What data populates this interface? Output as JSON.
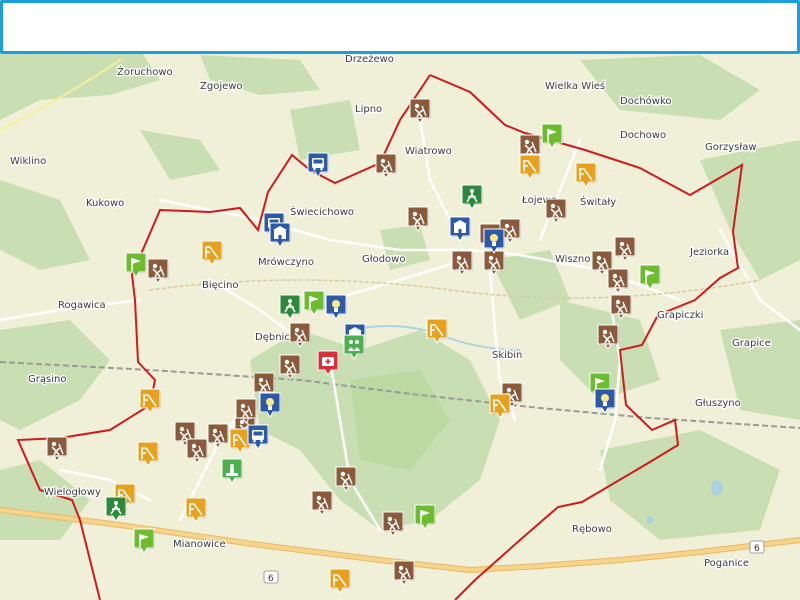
{
  "colors": {
    "boundary": "#d2181c",
    "panel_border": "#1a9ee0",
    "forest": "#c7deb3",
    "farmland": "#eef0d4",
    "water": "#aad3df",
    "road_primary": "#f7d48a",
    "railway": "#8a8a8a"
  },
  "places": [
    {
      "id": "drzewo",
      "label": "Drzeżewo"
    },
    {
      "id": "zoruchowo",
      "label": "Żoruchowo"
    },
    {
      "id": "zgojewo",
      "label": "Zgojewo"
    },
    {
      "id": "wielka-wies",
      "label": "Wielka Wieś"
    },
    {
      "id": "dochowko",
      "label": "Dochówko"
    },
    {
      "id": "lipno",
      "label": "Lipno"
    },
    {
      "id": "dochowo",
      "label": "Dochowo"
    },
    {
      "id": "wiklino",
      "label": "Wiklino"
    },
    {
      "id": "wiatrowo",
      "label": "Wiatrowo"
    },
    {
      "id": "gorzyslaw",
      "label": "Gorzysław"
    },
    {
      "id": "kukowo",
      "label": "Kukowo"
    },
    {
      "id": "swiecichowo",
      "label": "Świecichowo"
    },
    {
      "id": "lojewo",
      "label": "Łojewo"
    },
    {
      "id": "switaly",
      "label": "Świtały"
    },
    {
      "id": "mrowczyno",
      "label": "Mrówczyno"
    },
    {
      "id": "glodowo",
      "label": "Głodowo"
    },
    {
      "id": "wiszno",
      "label": "Wiszno"
    },
    {
      "id": "jeziorka",
      "label": "Jeziorka"
    },
    {
      "id": "biecino",
      "label": "Bięcino"
    },
    {
      "id": "rogawica",
      "label": "Rogawica"
    },
    {
      "id": "grapiczki",
      "label": "Grapiczki"
    },
    {
      "id": "debnica",
      "label": "Dębnica"
    },
    {
      "id": "grapice",
      "label": "Grapice"
    },
    {
      "id": "skibin",
      "label": "Skibin"
    },
    {
      "id": "grasino",
      "label": "Grąsino"
    },
    {
      "id": "gluszyno",
      "label": "Głuszyno"
    },
    {
      "id": "wielogłowy",
      "label": "Wielogłowy"
    },
    {
      "id": "mianowice",
      "label": "Mianowice"
    },
    {
      "id": "rebowo",
      "label": "Rębowo"
    },
    {
      "id": "poganice",
      "label": "Poganice"
    },
    {
      "id": "road6a",
      "label": "6"
    },
    {
      "id": "road6b",
      "label": "6"
    }
  ],
  "markers": [
    {
      "type": "pit"
    },
    {
      "type": "pit"
    },
    {
      "type": "pit"
    },
    {
      "type": "pit"
    },
    {
      "type": "pit"
    },
    {
      "type": "pit"
    },
    {
      "type": "pit"
    },
    {
      "type": "pit"
    },
    {
      "type": "pit"
    },
    {
      "type": "pit"
    },
    {
      "type": "pit"
    },
    {
      "type": "pit"
    },
    {
      "type": "pit"
    },
    {
      "type": "pit"
    },
    {
      "type": "pit"
    },
    {
      "type": "pit"
    },
    {
      "type": "pit"
    },
    {
      "type": "pit"
    },
    {
      "type": "pit"
    },
    {
      "type": "pit"
    },
    {
      "type": "pit"
    },
    {
      "type": "pit"
    },
    {
      "type": "pit"
    },
    {
      "type": "pit"
    },
    {
      "type": "pit"
    },
    {
      "type": "pit"
    },
    {
      "type": "pit"
    },
    {
      "type": "pit"
    },
    {
      "type": "pit"
    },
    {
      "type": "playground"
    },
    {
      "type": "playground"
    },
    {
      "type": "playground"
    },
    {
      "type": "playground"
    },
    {
      "type": "playground"
    },
    {
      "type": "playground"
    },
    {
      "type": "playground"
    },
    {
      "type": "playground"
    },
    {
      "type": "playground"
    },
    {
      "type": "playground"
    },
    {
      "type": "playground"
    },
    {
      "type": "flag"
    },
    {
      "type": "flag"
    },
    {
      "type": "flag"
    },
    {
      "type": "flag"
    },
    {
      "type": "flag"
    },
    {
      "type": "flag"
    },
    {
      "type": "flag"
    },
    {
      "type": "bulb"
    },
    {
      "type": "bulb"
    },
    {
      "type": "bulb"
    },
    {
      "type": "bulb"
    },
    {
      "type": "bus"
    },
    {
      "type": "bus"
    },
    {
      "type": "bus"
    },
    {
      "type": "school"
    },
    {
      "type": "school"
    },
    {
      "type": "school"
    },
    {
      "type": "fitness"
    },
    {
      "type": "fitness"
    },
    {
      "type": "fitness"
    },
    {
      "type": "medical"
    },
    {
      "type": "monument"
    },
    {
      "type": "people"
    }
  ],
  "marker_styles": {
    "pit": {
      "color": "#8a5a3b",
      "icon": "digging-icon"
    },
    "playground": {
      "color": "#e8a11c",
      "icon": "slide-icon"
    },
    "flag": {
      "color": "#6dbb2e",
      "icon": "flag-icon"
    },
    "bulb": {
      "color": "#2a5aa8",
      "icon": "lightbulb-icon"
    },
    "bus": {
      "color": "#2a5aa8",
      "icon": "bus-stop-icon"
    },
    "school": {
      "color": "#2a5aa8",
      "icon": "building-icon"
    },
    "fitness": {
      "color": "#2d8a3a",
      "icon": "outdoor-gym-icon"
    },
    "medical": {
      "color": "#d6303a",
      "icon": "medical-icon"
    },
    "monument": {
      "color": "#4caf50",
      "icon": "monument-icon"
    },
    "people": {
      "color": "#4caf50",
      "icon": "people-icon"
    }
  }
}
